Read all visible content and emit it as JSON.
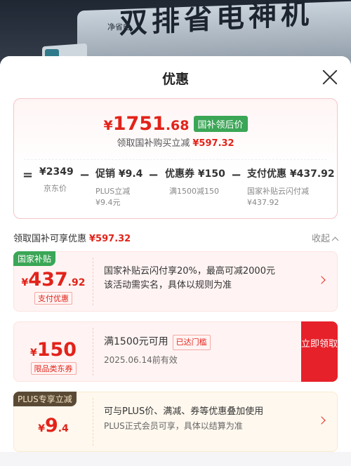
{
  "background": {
    "headline": "双排省电神机",
    "brand": "净省电"
  },
  "sheet": {
    "title": "优惠",
    "close_icon": "close-icon"
  },
  "summary": {
    "final_currency": "¥",
    "final_int": "1751",
    "final_dec": ".68",
    "final_tag": "国补领后价",
    "claim_text": "领取国补购买立减",
    "claim_amount": "¥597.32",
    "formula": [
      {
        "op": "=",
        "label": "¥2349",
        "sub1": "京东价",
        "sub2": ""
      },
      {
        "op": "−",
        "label": "促销 ¥9.4",
        "sub1": "PLUS立减",
        "sub2": "¥9.4元"
      },
      {
        "op": "−",
        "label": "优惠券 ¥150",
        "sub1": "满1500减150",
        "sub2": ""
      },
      {
        "op": "−",
        "label": "支付优惠 ¥437.92",
        "sub1": "国家补贴云闪付减",
        "sub2": "¥437.92"
      }
    ]
  },
  "section": {
    "title": "领取国补可享优惠",
    "amount": "¥597.32",
    "collapse_label": "收起"
  },
  "cards": [
    {
      "badge": "国家补贴",
      "currency": "¥",
      "int": "437",
      "dec": ".92",
      "tag": "支付优惠",
      "line1": "国家补贴云闪付享20%，最高可减2000元",
      "line2": "该活动需实名，具体以规则为准"
    },
    {
      "currency": "¥",
      "int": "150",
      "dec": "",
      "tag": "限品类东券",
      "line1": "满1500元可用",
      "threshold": "已达门槛",
      "line2": "2025.06.14前有效",
      "button": "立即领取"
    },
    {
      "badge": "PLUS专享立减",
      "currency": "¥",
      "int": "9",
      "dec": ".4",
      "line1": "可与PLUS价、满减、券等优惠叠加使用",
      "line2": "PLUS正式会员可享，具体以结算为准"
    }
  ],
  "colors": {
    "accent_red": "#e2231a",
    "green_tag": "#3aa656",
    "plus_badge": "#5a4a35"
  }
}
